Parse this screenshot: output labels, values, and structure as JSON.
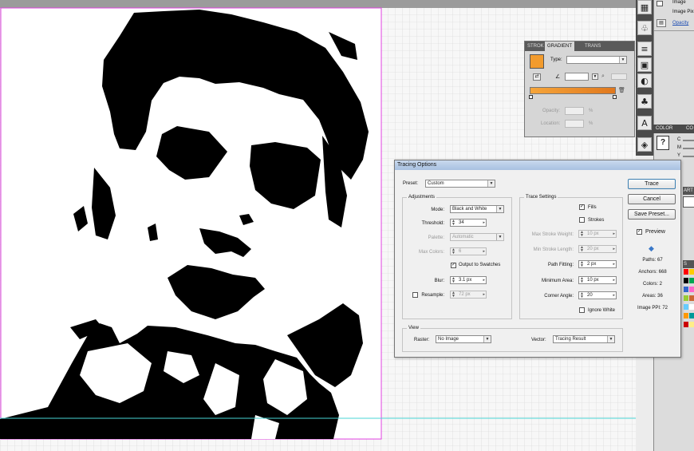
{
  "dock": {
    "image_label": "Image",
    "image_pix_label": "Image Pix",
    "opacity_link": "Opacity"
  },
  "color_panel": {
    "tab_color": "COLOR",
    "tab_co": "CO",
    "row_c": "C",
    "row_m": "M",
    "row_y": "Y"
  },
  "art_tab": "ART",
  "swatches_tab": "S",
  "gradient_panel": {
    "tabs": [
      "STROK",
      "GRADIENT",
      "TRANS"
    ],
    "type_label": "Type:",
    "type_value": "",
    "opacity_label": "Opacity:",
    "opacity_unit": "%",
    "location_label": "Location:",
    "location_unit": "%",
    "gradient_from": "#f6a53a",
    "gradient_to": "#e0781e"
  },
  "dialog": {
    "title": "Tracing Options",
    "preset_label": "Preset:",
    "preset_value": "Custom",
    "adjustments": {
      "title": "Adjustments",
      "mode_label": "Mode:",
      "mode_value": "Black and White",
      "threshold_label": "Threshold:",
      "threshold_value": "34",
      "palette_label": "Palette:",
      "palette_value": "Automatic",
      "max_colors_label": "Max Colors:",
      "max_colors_value": "6",
      "output_swatches_label": "Output to Swatches",
      "output_swatches_checked": true,
      "blur_label": "Blur:",
      "blur_value": "3.1 px",
      "resample_label": "Resample:",
      "resample_value": "72 px",
      "resample_checked": false
    },
    "trace_settings": {
      "title": "Trace Settings",
      "fills_label": "Fills",
      "fills_checked": true,
      "strokes_label": "Strokes",
      "strokes_checked": false,
      "max_stroke_weight_label": "Max Stroke Weight:",
      "max_stroke_weight_value": "10 px",
      "min_stroke_length_label": "Min Stroke Length:",
      "min_stroke_length_value": "20 px",
      "path_fitting_label": "Path Fitting:",
      "path_fitting_value": "2 px",
      "minimum_area_label": "Minimum Area:",
      "minimum_area_value": "10 px",
      "corner_angle_label": "Corner Angle:",
      "corner_angle_value": "20",
      "ignore_white_label": "Ignore White",
      "ignore_white_checked": false
    },
    "view": {
      "title": "View",
      "raster_label": "Raster:",
      "raster_value": "No Image",
      "vector_label": "Vector:",
      "vector_value": "Tracing Result"
    },
    "buttons": {
      "trace": "Trace",
      "cancel": "Cancel",
      "save_preset": "Save Preset..."
    },
    "preview_label": "Preview",
    "preview_checked": true,
    "stats": {
      "paths": "Paths: 67",
      "anchors": "Anchors: 668",
      "colors": "Colors: 2",
      "areas": "Areas: 36",
      "image_ppi": "Image PPI: 72"
    }
  },
  "colors": {
    "artboard_border": "#e040e0",
    "guide": "#49d6d6",
    "dialog_title": "#b9cde8"
  }
}
